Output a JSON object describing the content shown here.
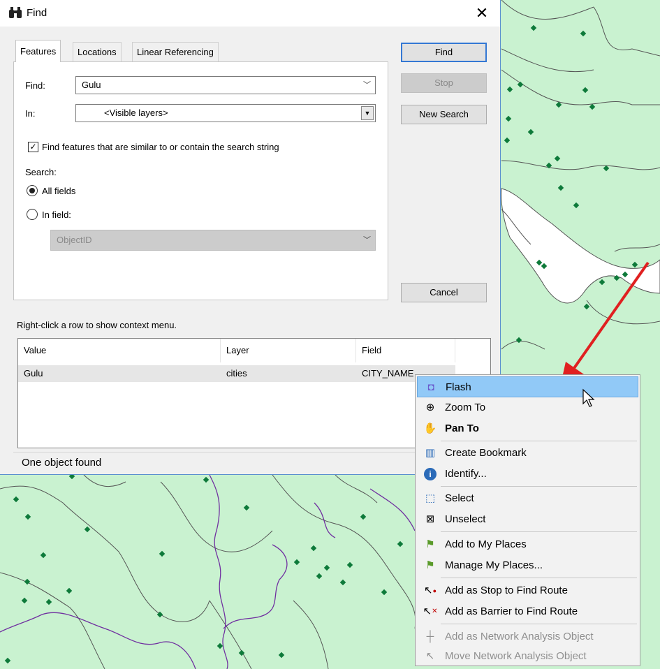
{
  "colors": {
    "map_fill": "#c9f2d0",
    "water": "#ffffff",
    "boundary": "#555555",
    "river": "#7030a0",
    "point": "#0e7a3a",
    "accent": "#3478d4",
    "arrow": "#e02020",
    "menu_hover": "#91c9f7"
  },
  "dialog": {
    "title": "Find",
    "close": "✕",
    "tabs": [
      "Features",
      "Locations",
      "Linear Referencing"
    ],
    "find_label": "Find:",
    "find_value": "Gulu",
    "in_label": "In:",
    "in_value": "<Visible layers>",
    "similar_checkbox": "Find features that are similar to or contain the search string",
    "search_label": "Search:",
    "radio_all": "All fields",
    "radio_field": "In field:",
    "field_value": "ObjectID",
    "buttons": {
      "find": "Find",
      "stop": "Stop",
      "new_search": "New Search",
      "cancel": "Cancel"
    },
    "hint": "Right-click a row to show context menu.",
    "columns": [
      "Value",
      "Layer",
      "Field"
    ],
    "rows": [
      {
        "value": "Gulu",
        "layer": "cities",
        "field": "CITY_NAME"
      }
    ],
    "status": "One object found"
  },
  "menu": {
    "items": [
      {
        "label": "Flash",
        "icon": "flash-icon",
        "glyph": "◘"
      },
      {
        "label": "Zoom To",
        "icon": "zoom-icon",
        "glyph": "⊕"
      },
      {
        "label": "Pan To",
        "icon": "pan-hand-icon",
        "glyph": "✋"
      },
      {
        "label": "Create Bookmark",
        "icon": "bookmark-icon",
        "glyph": "▥"
      },
      {
        "label": "Identify...",
        "icon": "info-icon",
        "glyph": "i"
      },
      {
        "label": "Select",
        "icon": "select-icon",
        "glyph": "⬚"
      },
      {
        "label": "Unselect",
        "icon": "unselect-icon",
        "glyph": "⊠"
      },
      {
        "label": "Add to My Places",
        "icon": "flag-add-icon",
        "glyph": "⚑"
      },
      {
        "label": "Manage My Places...",
        "icon": "flag-icon",
        "glyph": "⚑"
      },
      {
        "label": "Add as Stop to Find Route",
        "icon": "route-stop-icon",
        "glyph": "↖"
      },
      {
        "label": "Add as Barrier to Find Route",
        "icon": "route-barrier-icon",
        "glyph": "↖"
      },
      {
        "label": "Add as Network Analysis Object",
        "icon": "network-add-icon",
        "glyph": "┼"
      },
      {
        "label": "Move Network Analysis Object",
        "icon": "network-move-icon",
        "glyph": "↖"
      }
    ]
  }
}
